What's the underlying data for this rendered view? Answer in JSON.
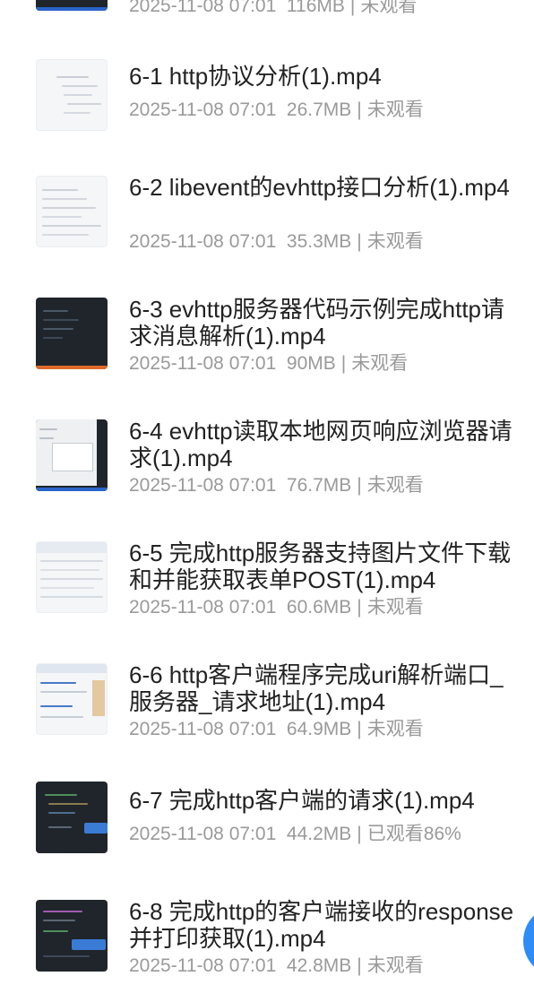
{
  "top_partial": {
    "date": "2025-11-08 07:01",
    "size": "116MB",
    "status": "未观看"
  },
  "separator": "|",
  "videos": [
    {
      "title": "6-1 http协议分析(1).mp4",
      "date": "2025-11-08 07:01",
      "size": "26.7MB",
      "status": "未观看",
      "thumb": "light"
    },
    {
      "title": "6-2 libevent的evhttp接口分析(1).mp4",
      "date": "2025-11-08 07:01",
      "size": "35.3MB",
      "status": "未观看",
      "thumb": "light"
    },
    {
      "title": "6-3 evhttp服务器代码示例完成http请求消息解析(1).mp4",
      "date": "2025-11-08 07:01",
      "size": "90MB",
      "status": "未观看",
      "thumb": "dark"
    },
    {
      "title": "6-4 evhttp读取本地网页响应浏览器请求(1).mp4",
      "date": "2025-11-08 07:01",
      "size": "76.7MB",
      "status": "未观看",
      "thumb": "mixed"
    },
    {
      "title": "6-5 完成http服务器支持图片文件下载和并能获取表单POST(1).mp4",
      "date": "2025-11-08 07:01",
      "size": "60.6MB",
      "status": "未观看",
      "thumb": "light"
    },
    {
      "title": "6-6 http客户端程序完成uri解析端口_服务器_请求地址(1).mp4",
      "date": "2025-11-08 07:01",
      "size": "64.9MB",
      "status": "未观看",
      "thumb": "light"
    },
    {
      "title": "6-7 完成http客户端的请求(1).mp4",
      "date": "2025-11-08 07:01",
      "size": "44.2MB",
      "status": "已观看86%",
      "thumb": "dark"
    },
    {
      "title": "6-8 完成http的客户端接收的response并打印获取(1).mp4",
      "date": "2025-11-08 07:01",
      "size": "42.8MB",
      "status": "未观看",
      "thumb": "dark"
    }
  ],
  "colors": {
    "accent": "#2f8cf6",
    "title": "#222222",
    "meta": "#9a9a9a"
  },
  "icons": {
    "fab": "floating-action-button"
  }
}
